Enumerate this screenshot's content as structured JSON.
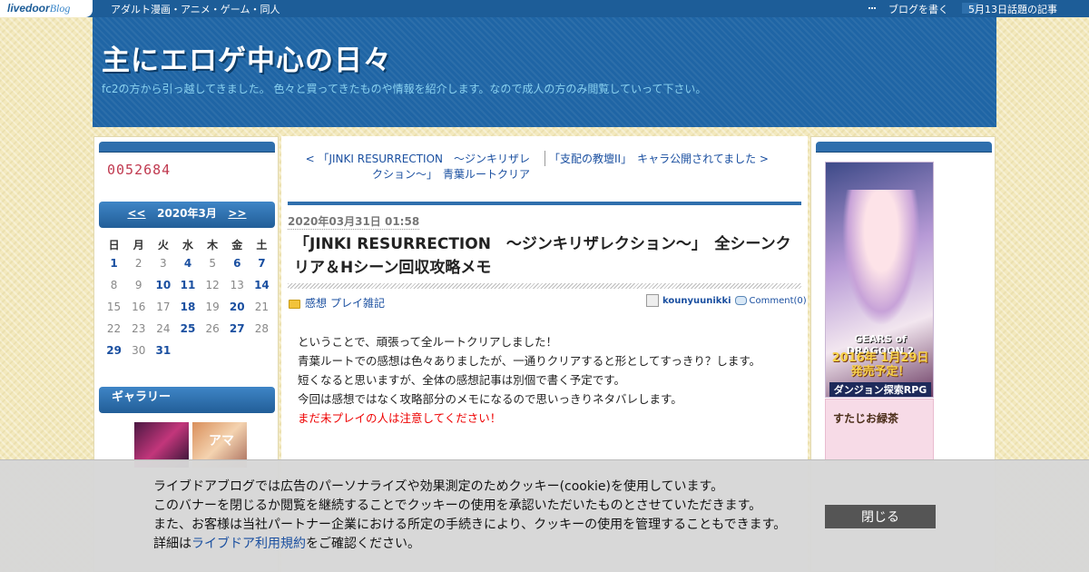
{
  "topbar": {
    "logo_main": "livedoor",
    "logo_sub": "Blog",
    "tagline": "アダルト漫画・アニメ・ゲーム・同人",
    "write_label": "ブログを書く",
    "topic_label": "5月13日話題の記事"
  },
  "header": {
    "title": "主にエロゲ中心の日々",
    "description": "fc2の方から引っ越してきました。 色々と買ってきたものや情報を紹介します。なので成人の方のみ閲覧していって下さい。"
  },
  "sidebar": {
    "counter": "0052684",
    "calendar": {
      "prev": "<<",
      "title": "2020年3月",
      "next": ">>",
      "weekdays": [
        "日",
        "月",
        "火",
        "水",
        "木",
        "金",
        "土"
      ],
      "weeks": [
        [
          {
            "d": "1",
            "link": true
          },
          {
            "d": "2",
            "link": false
          },
          {
            "d": "3",
            "link": false
          },
          {
            "d": "4",
            "link": true
          },
          {
            "d": "5",
            "link": false
          },
          {
            "d": "6",
            "link": true
          },
          {
            "d": "7",
            "link": true
          }
        ],
        [
          {
            "d": "8",
            "link": false
          },
          {
            "d": "9",
            "link": false
          },
          {
            "d": "10",
            "link": true
          },
          {
            "d": "11",
            "link": true
          },
          {
            "d": "12",
            "link": false
          },
          {
            "d": "13",
            "link": false
          },
          {
            "d": "14",
            "link": true
          }
        ],
        [
          {
            "d": "15",
            "link": false
          },
          {
            "d": "16",
            "link": false
          },
          {
            "d": "17",
            "link": false
          },
          {
            "d": "18",
            "link": true
          },
          {
            "d": "19",
            "link": false
          },
          {
            "d": "20",
            "link": true
          },
          {
            "d": "21",
            "link": false
          }
        ],
        [
          {
            "d": "22",
            "link": false
          },
          {
            "d": "23",
            "link": false
          },
          {
            "d": "24",
            "link": false
          },
          {
            "d": "25",
            "link": true
          },
          {
            "d": "26",
            "link": false
          },
          {
            "d": "27",
            "link": true
          },
          {
            "d": "28",
            "link": false
          }
        ],
        [
          {
            "d": "29",
            "link": true
          },
          {
            "d": "30",
            "link": false
          },
          {
            "d": "31",
            "link": true
          },
          {
            "d": "",
            "link": false
          },
          {
            "d": "",
            "link": false
          },
          {
            "d": "",
            "link": false
          },
          {
            "d": "",
            "link": false
          }
        ]
      ]
    },
    "gallery_title": "ギャラリー",
    "gallery_thumb_2_text": "アマ"
  },
  "post": {
    "nav_prev": "< 「JINKI RESURRECTION　～ジンキリザレクション～」　青葉ルートクリア",
    "nav_next": "「支配の教壇II」　キャラ公開されてました >",
    "date": "2020年03月31日 01:58",
    "title": "「JINKI RESURRECTION　～ジンキリザレクション～」　全シーンクリア＆Hシーン回収攻略メモ",
    "categories": [
      "感想",
      "プレイ雑記"
    ],
    "author": "kounyuunikki",
    "comment_label": "Comment(0)",
    "body": [
      "ということで、頑張って全ルートクリアしました！",
      "青葉ルートでの感想は色々ありましたが、一通りクリアすると形としてすっきり？します。",
      "短くなると思いますが、全体の感想記事は別個で書く予定です。",
      "今回は感想ではなく攻略部分のメモになるので思いっきりネタバレします。"
    ],
    "warning": "まだ未プレイの人は注意してください！"
  },
  "ad": {
    "line1": "GEARS of DRAGOON 2",
    "line2": "2016年 1月29日発売予定！",
    "line3": "ダンジョン探索RPG",
    "ad2_text": "すたじお緑茶"
  },
  "cookie": {
    "line1": "ライブドアブログでは広告のパーソナライズや効果測定のためクッキー(cookie)を使用しています。",
    "line2": "このバナーを閉じるか閲覧を継続することでクッキーの使用を承認いただいたものとさせていただきます。",
    "line3": "また、お客様は当社パートナー企業における所定の手続きにより、クッキーの使用を管理することもできます。",
    "line4_pre": "詳細は",
    "line4_link": "ライブドア利用規約",
    "line4_post": "をご確認ください。",
    "close_label": "閉じる"
  }
}
